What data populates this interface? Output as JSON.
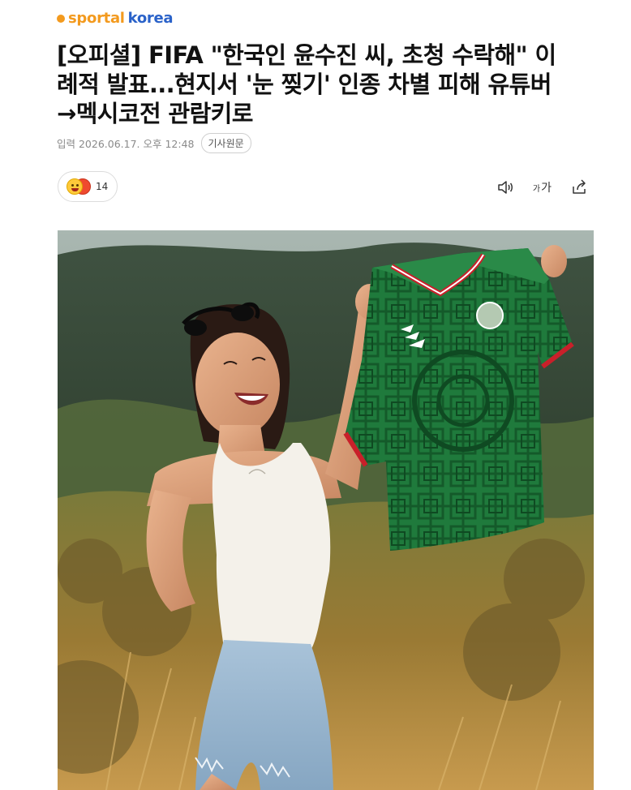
{
  "brand": {
    "prefix": "sportal",
    "suffix": "korea"
  },
  "article": {
    "headline_lines": [
      "[오피셜] FIFA \"한국인 윤수진 씨, 초청 수락해\" 이",
      "례적 발표...현지서 '눈 찢기' 인종 차별 피해 유튜버",
      "→멕시코전 관람키로"
    ],
    "published": "입력 2026.06.17. 오후 12:48",
    "source_button": "기사원문"
  },
  "reactions": {
    "count": "14"
  },
  "toolbar": {
    "font_small": "가",
    "font_large": "가",
    "icons": [
      "speaker-icon",
      "font-size-icon",
      "share-icon"
    ]
  },
  "colors": {
    "brand_orange": "#f39a1e",
    "brand_blue": "#2a62c9",
    "jersey_green": "#1f7a3c",
    "jersey_trim": "#c8202a"
  }
}
